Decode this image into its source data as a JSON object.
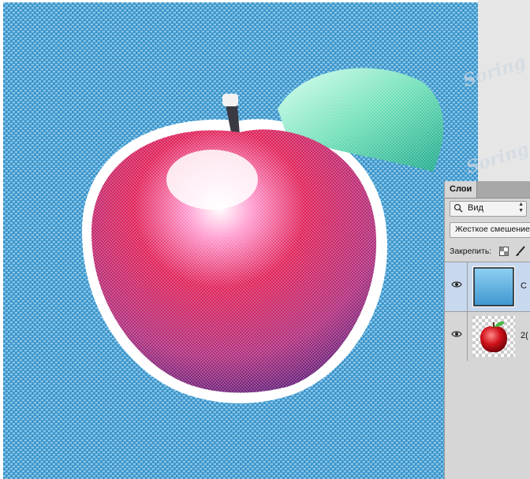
{
  "canvas": {
    "watermark_text": "Soring",
    "colors": {
      "background_texture": "#4aa3d6",
      "apple": "#d0327a",
      "leaf": "#6fe0b8"
    }
  },
  "layers_panel": {
    "tab_label": "Слои",
    "filter_kind": "Вид",
    "blend_mode": "Жесткое смешение",
    "lock_label": "Закрепить:",
    "layers": [
      {
        "name": "C",
        "selected": true,
        "visible": true,
        "thumb": "blue-gradient"
      },
      {
        "name": "2(",
        "selected": false,
        "visible": true,
        "thumb": "apple"
      }
    ]
  }
}
